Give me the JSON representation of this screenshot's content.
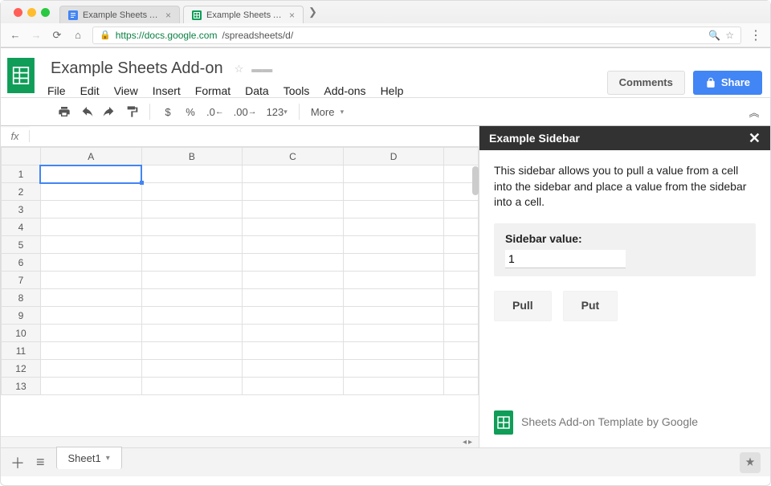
{
  "browser": {
    "tabs": [
      {
        "title": "Example Sheets Add-on",
        "favicon": "docs-blue"
      },
      {
        "title": "Example Sheets Add-on - Goo…",
        "favicon": "sheets-green"
      }
    ],
    "url_host": "https://docs.google.com",
    "url_path": "/spreadsheets/d/"
  },
  "doc": {
    "title": "Example Sheets Add-on",
    "menus": [
      "File",
      "Edit",
      "View",
      "Insert",
      "Format",
      "Data",
      "Tools",
      "Add-ons",
      "Help"
    ],
    "comments_label": "Comments",
    "share_label": "Share"
  },
  "toolbar": {
    "currency": "$",
    "percent": "%",
    "dec_dec": ".0←",
    "dec_inc": ".00→",
    "numfmt": "123",
    "more": "More",
    "collapse": "︽"
  },
  "fx": {
    "label": "fx",
    "value": ""
  },
  "grid": {
    "columns": [
      "A",
      "B",
      "C",
      "D"
    ],
    "rows": [
      1,
      2,
      3,
      4,
      5,
      6,
      7,
      8,
      9,
      10,
      11,
      12,
      13
    ],
    "selected": {
      "row": 1,
      "col": "A"
    }
  },
  "sidebar": {
    "title": "Example Sidebar",
    "description": "This sidebar allows you to pull a value from a cell into the sidebar and place a value from the sidebar into a cell.",
    "panel_label": "Sidebar value:",
    "value": "1",
    "pull_label": "Pull",
    "put_label": "Put",
    "footer": "Sheets Add-on Template by Google"
  },
  "bottom": {
    "sheet_name": "Sheet1"
  }
}
